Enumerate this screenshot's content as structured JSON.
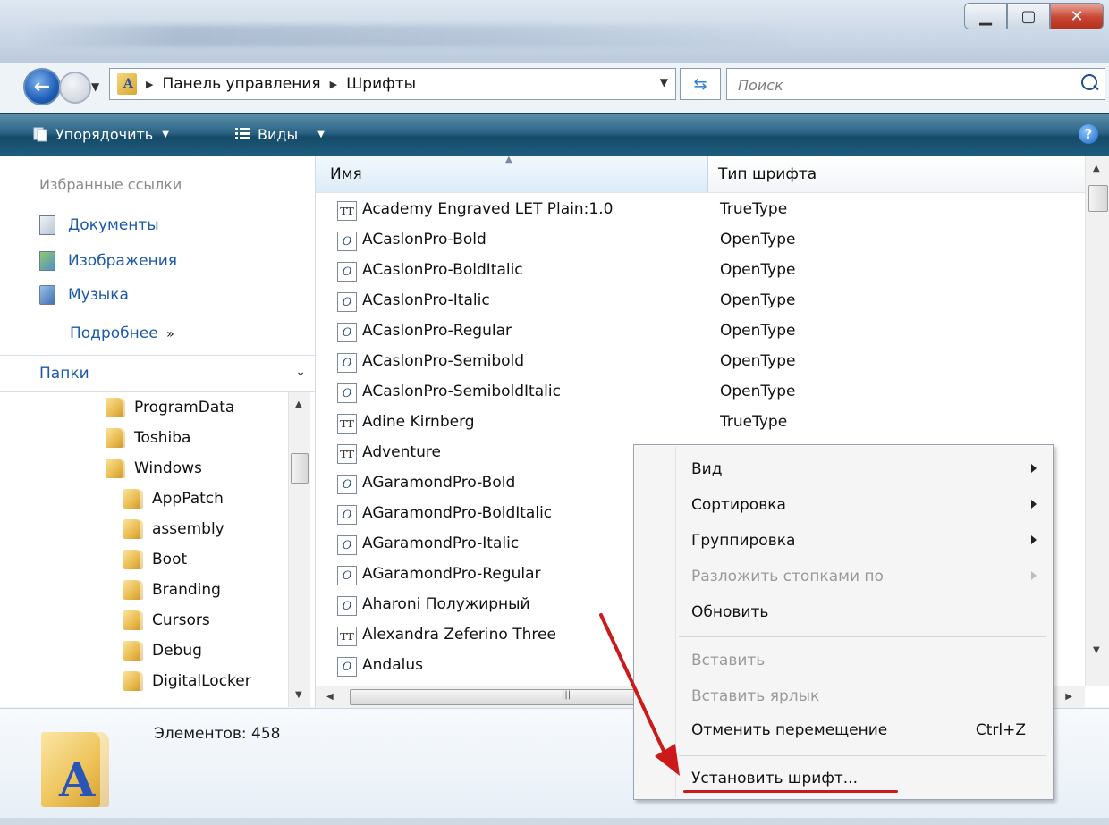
{
  "address": {
    "crumbs": [
      "Панель управления",
      "Шрифты"
    ],
    "search_placeholder": "Поиск"
  },
  "toolbar": {
    "organize_label": "Упорядочить",
    "views_label": "Виды"
  },
  "sidebar": {
    "favorites_title": "Избранные ссылки",
    "favorites": [
      {
        "label": "Документы",
        "icon": "documents-icon"
      },
      {
        "label": "Изображения",
        "icon": "pictures-icon"
      },
      {
        "label": "Музыка",
        "icon": "music-icon"
      }
    ],
    "more_label": "Подробнее",
    "folders_label": "Папки",
    "tree": [
      {
        "label": "ProgramData",
        "level": 1
      },
      {
        "label": "Toshiba",
        "level": 1
      },
      {
        "label": "Windows",
        "level": 1
      },
      {
        "label": "AppPatch",
        "level": 2
      },
      {
        "label": "assembly",
        "level": 2
      },
      {
        "label": "Boot",
        "level": 2
      },
      {
        "label": "Branding",
        "level": 2
      },
      {
        "label": "Cursors",
        "level": 2
      },
      {
        "label": "Debug",
        "level": 2
      },
      {
        "label": "DigitalLocker",
        "level": 2
      }
    ]
  },
  "list": {
    "columns": {
      "name": "Имя",
      "type": "Тип шрифта"
    },
    "rows": [
      {
        "name": "Academy Engraved LET Plain:1.0",
        "type": "TrueType",
        "icon": "truetype-font-icon"
      },
      {
        "name": "ACaslonPro-Bold",
        "type": "OpenType",
        "icon": "opentype-font-icon"
      },
      {
        "name": "ACaslonPro-BoldItalic",
        "type": "OpenType",
        "icon": "opentype-font-icon"
      },
      {
        "name": "ACaslonPro-Italic",
        "type": "OpenType",
        "icon": "opentype-font-icon"
      },
      {
        "name": "ACaslonPro-Regular",
        "type": "OpenType",
        "icon": "opentype-font-icon"
      },
      {
        "name": "ACaslonPro-Semibold",
        "type": "OpenType",
        "icon": "opentype-font-icon"
      },
      {
        "name": "ACaslonPro-SemiboldItalic",
        "type": "OpenType",
        "icon": "opentype-font-icon"
      },
      {
        "name": "Adine Kirnberg",
        "type": "TrueType",
        "icon": "truetype-font-icon"
      },
      {
        "name": "Adventure",
        "type": "",
        "icon": "truetype-font-icon"
      },
      {
        "name": "AGaramondPro-Bold",
        "type": "",
        "icon": "opentype-font-icon"
      },
      {
        "name": "AGaramondPro-BoldItalic",
        "type": "",
        "icon": "opentype-font-icon"
      },
      {
        "name": "AGaramondPro-Italic",
        "type": "",
        "icon": "opentype-font-icon"
      },
      {
        "name": "AGaramondPro-Regular",
        "type": "",
        "icon": "opentype-font-icon"
      },
      {
        "name": "Aharoni Полужирный",
        "type": "",
        "icon": "opentype-font-icon"
      },
      {
        "name": "Alexandra Zeferino Three",
        "type": "",
        "icon": "truetype-font-icon"
      },
      {
        "name": "Andalus",
        "type": "",
        "icon": "opentype-font-icon"
      }
    ]
  },
  "details": {
    "count_label": "Элементов: 458"
  },
  "context_menu": {
    "items": [
      {
        "label": "Вид",
        "submenu": true,
        "disabled": false
      },
      {
        "label": "Сортировка",
        "submenu": true,
        "disabled": false
      },
      {
        "label": "Группировка",
        "submenu": true,
        "disabled": false
      },
      {
        "label": "Разложить стопками по",
        "submenu": true,
        "disabled": true
      },
      {
        "label": "Обновить",
        "submenu": false,
        "disabled": false
      },
      {
        "label": "Вставить",
        "submenu": false,
        "disabled": true
      },
      {
        "label": "Вставить ярлык",
        "submenu": false,
        "disabled": true
      },
      {
        "label": "Отменить перемещение",
        "submenu": false,
        "disabled": false,
        "shortcut": "Ctrl+Z"
      },
      {
        "label": "Установить шрифт...",
        "submenu": false,
        "disabled": false
      }
    ]
  },
  "colors": {
    "accent": "#1c5aa6",
    "annotation": "#cc1a1a"
  }
}
